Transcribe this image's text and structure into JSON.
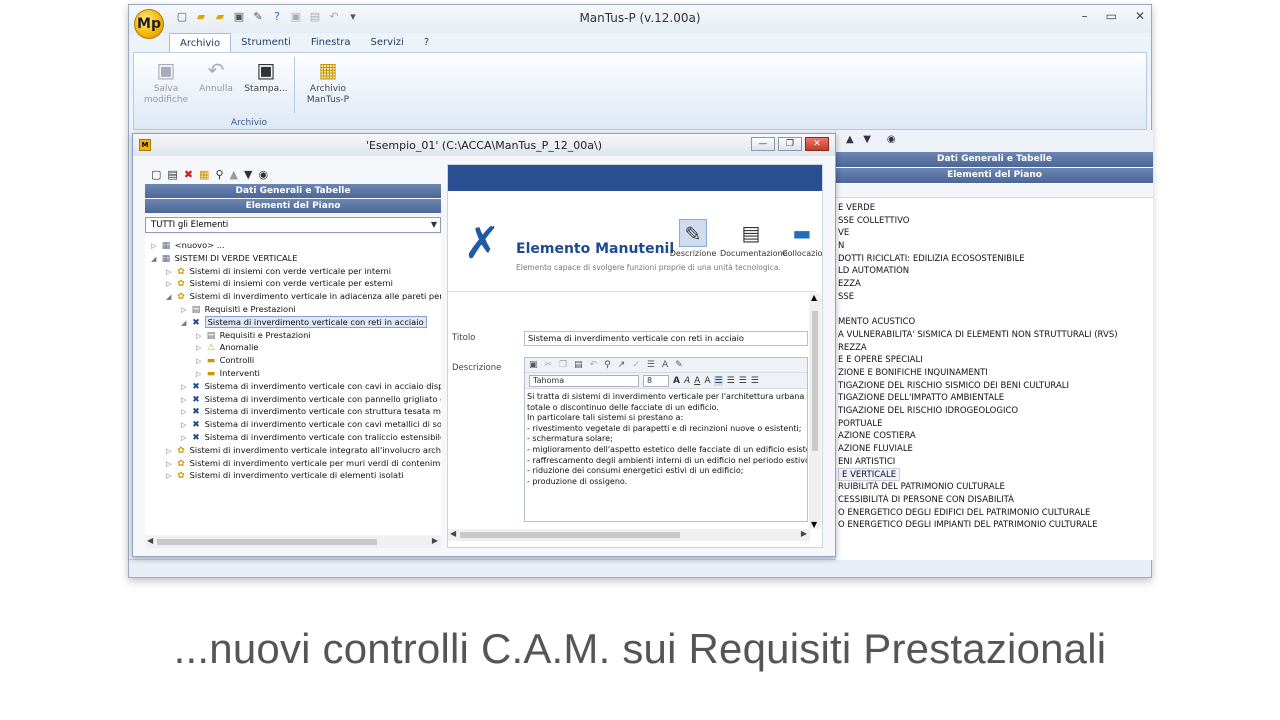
{
  "app": {
    "title": "ManTus-P (v.12.00a)",
    "logo_text": "Mp",
    "tabs": [
      "Archivio",
      "Strumenti",
      "Finestra",
      "Servizi",
      "?"
    ],
    "ribbon_buttons": [
      "Salva modifiche",
      "Annulla",
      "Stampa...",
      "Archivio ManTus-P"
    ],
    "ribbon_group": "Archivio"
  },
  "background_panel": {
    "bands": [
      "Dati Generali e Tabelle",
      "Elementi del Piano"
    ],
    "items": [
      "E VERDE",
      "SSE COLLETTIVO",
      "VE",
      "N",
      "DOTTI RICICLATI: EDILIZIA ECOSOSTENIBILE",
      "LD AUTOMATION",
      "EZZA",
      "SSE",
      "",
      "MENTO ACUSTICO",
      "A VULNERABILITA' SISMICA DI ELEMENTI NON STRUTTURALI (RVS)",
      "REZZA",
      "E E OPERE SPECIALI",
      "ZIONE E BONIFICHE INQUINAMENTI",
      "TIGAZIONE DEL RISCHIO SISMICO DEI BENI CULTURALI",
      "TIGAZIONE DELL'IMPATTO AMBIENTALE",
      "TIGAZIONE DEL RISCHIO IDROGEOLOGICO",
      "PORTUALE",
      "AZIONE COSTIERA",
      "AZIONE FLUVIALE",
      "ENI ARTISTICI",
      "E VERTICALE",
      "RUIBILITÀ DEL PATRIMONIO CULTURALE",
      "CESSIBILITÀ DI PERSONE CON DISABILITÀ",
      "O ENERGETICO DEGLI EDIFICI DEL PATRIMONIO CULTURALE",
      "O ENERGETICO DEGLI IMPIANTI DEL PATRIMONIO CULTURALE"
    ]
  },
  "child": {
    "title": "'Esempio_01'   (C:\\ACCA\\ManTus_P_12_00a\\)",
    "bands": [
      "Dati Generali e Tabelle",
      "Elementi del Piano"
    ],
    "filter": "TUTTI gli Elementi",
    "tree": [
      {
        "label": "<nuovo> ...",
        "level": 0,
        "tw": "▷",
        "icon": "▦"
      },
      {
        "label": "SISTEMI DI VERDE VERTICALE",
        "level": 0,
        "tw": "◢",
        "icon": "▦"
      },
      {
        "label": "Sistemi di insiemi con verde verticale per interni",
        "level": 1,
        "tw": "▷",
        "icon": "✿"
      },
      {
        "label": "Sistemi di insiemi con verde verticale per esterni",
        "level": 1,
        "tw": "▷",
        "icon": "✿"
      },
      {
        "label": "Sistemi di inverdimento verticale in adiacenza alle pareti perimetr",
        "level": 1,
        "tw": "◢",
        "icon": "✿"
      },
      {
        "label": "Requisiti e Prestazioni",
        "level": 2,
        "tw": "▷",
        "icon": "▤"
      },
      {
        "label": "Sistema di inverdimento verticale con reti in acciaio",
        "level": 2,
        "tw": "◢",
        "icon": "✖",
        "sel": true
      },
      {
        "label": "Requisiti e Prestazioni",
        "level": 3,
        "tw": "▷",
        "icon": "▤"
      },
      {
        "label": "Anomalie",
        "level": 3,
        "tw": "▷",
        "icon": "⚠"
      },
      {
        "label": "Controlli",
        "level": 3,
        "tw": "▷",
        "icon": "▬"
      },
      {
        "label": "Interventi",
        "level": 3,
        "tw": "▷",
        "icon": "▬"
      },
      {
        "label": "Sistema di inverdimento verticale con cavi in acciaio disposti",
        "level": 2,
        "tw": "▷",
        "icon": "✖"
      },
      {
        "label": "Sistema di inverdimento verticale con pannello grigliato e vas",
        "level": 2,
        "tw": "▷",
        "icon": "✖"
      },
      {
        "label": "Sistema di inverdimento verticale con struttura tesata media",
        "level": 2,
        "tw": "▷",
        "icon": "✖"
      },
      {
        "label": "Sistema di inverdimento verticale con cavi metallici di sostegr",
        "level": 2,
        "tw": "▷",
        "icon": "✖"
      },
      {
        "label": "Sistema di inverdimento verticale con traliccio estensibile",
        "level": 2,
        "tw": "▷",
        "icon": "✖"
      },
      {
        "label": "Sistemi di inverdimento verticale integrato all'involucro architetto",
        "level": 1,
        "tw": "▷",
        "icon": "✿"
      },
      {
        "label": "Sistemi di inverdimento verticale per muri verdi di contenimento",
        "level": 1,
        "tw": "▷",
        "icon": "✿"
      },
      {
        "label": "Sistemi di inverdimento verticale di elementi isolati",
        "level": 1,
        "tw": "▷",
        "icon": "✿"
      }
    ],
    "detail": {
      "title": "Elemento Manutenil",
      "subtitle": "Elemento capace di svolgere funzioni proprie di una unità tecnologica.",
      "segments": [
        "Descrizione",
        "Documentazione",
        "Collocazio"
      ],
      "titolo_label": "Titolo",
      "titolo_value": "Sistema di inverdimento verticale con reti in acciaio",
      "descrizione_label": "Descrizione",
      "font": "Tahoma",
      "size": "8",
      "text_lines": [
        "Si tratta di sistemi di inverdimento verticale per l'architettura urbana con fi",
        "totale o discontinuo delle facciate di un edificio.",
        "In particolare tali sistemi si prestano a:",
        "- rivestimento vegetale di parapetti e di recinzioni nuove o esistenti;",
        "- schermatura solare;",
        "- miglioramento dell'aspetto estetico delle facciate di un edificio esistente;",
        "- raffrescamento degli ambienti interni di un edificio nel periodo estivo;",
        "- riduzione dei consumi energetici estivi di un edificio;",
        "- produzione di ossigeno."
      ]
    }
  },
  "caption": "...nuovi controlli C.A.M. sui Requisiti Prestazionali",
  "colors": {
    "header_blue": "#2a4e92",
    "band_blue": "#4b6698",
    "accent": "#1f4a8f"
  }
}
